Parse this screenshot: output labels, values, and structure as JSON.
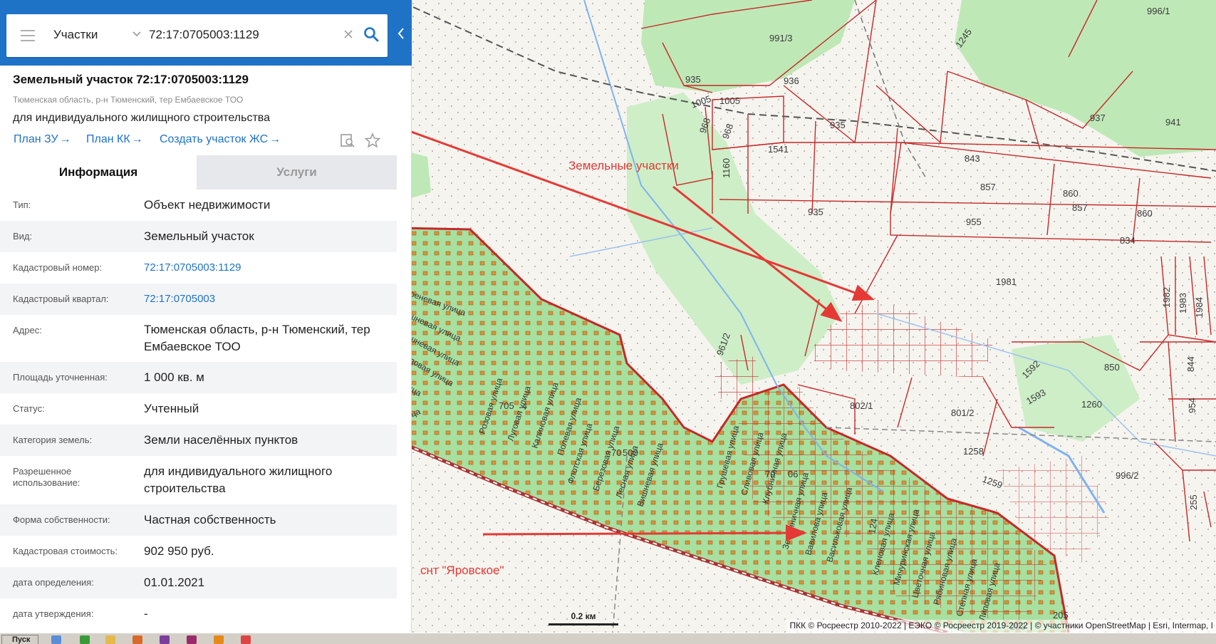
{
  "search": {
    "layer": "Участки",
    "query": "72:17:0705003:1129"
  },
  "parcel": {
    "title": "Земельный участок 72:17:0705003:1129",
    "address": "Тюменская область, р-н Тюменский, тер Ембаевское ТОО",
    "use": "для индивидуального жилищного строительства",
    "links": [
      "План ЗУ",
      "План КК",
      "Создать участок ЖС"
    ]
  },
  "tabs": [
    "Информация",
    "Услуги"
  ],
  "info": [
    {
      "label": "Тип:",
      "value": "Объект недвижимости"
    },
    {
      "label": "Вид:",
      "value": "Земельный участок"
    },
    {
      "label": "Кадастровый номер:",
      "value": "72:17:0705003:1129"
    },
    {
      "label": "Кадастровый квартал:",
      "value": "72:17:0705003"
    },
    {
      "label": "Адрес:",
      "value": "Тюменская область, р-н Тюменский, тер Ембаевское ТОО"
    },
    {
      "label": "Площадь уточненная:",
      "value": "1 000 кв. м"
    },
    {
      "label": "Статус:",
      "value": "Учтенный"
    },
    {
      "label": "Категория земель:",
      "value": "Земли населённых пунктов"
    },
    {
      "label": "Разрешенное использование:",
      "value": "для индивидуального жилищного строительства"
    },
    {
      "label": "Форма собственности:",
      "value": "Частная собственность"
    },
    {
      "label": "Кадастровая стоимость:",
      "value": "902 950 руб."
    },
    {
      "label": "дата определения:",
      "value": "01.01.2021"
    },
    {
      "label": "дата утверждения:",
      "value": "-"
    }
  ],
  "map": {
    "annotations": [
      "Земельные участки",
      "снт \"Яровское\""
    ],
    "parcel_numbers": [
      "991/3",
      "996/1",
      "1245",
      "935",
      "936",
      "937",
      "941",
      "1005",
      "1005",
      "968",
      "968",
      "935",
      "1541",
      "1160",
      "843",
      "857",
      "857",
      "860",
      "860",
      "935",
      "955",
      "834",
      "1981",
      "1982",
      "1983",
      "1984",
      "961/2",
      "850",
      "1592",
      "1593",
      "844",
      "802/1",
      "801/2",
      "1260",
      "954",
      "1258",
      "1259",
      "996/2",
      "255",
      "205",
      "203",
      "95"
    ],
    "block_labels": [
      "705",
      "4",
      "70",
      "500",
      "70",
      "06",
      "124"
    ],
    "streets": [
      "Сиреневая улица",
      "Сиреневая улица",
      "Вишневая улица",
      "Вишневая улица",
      "Садовая улица",
      "улица",
      "улица",
      "Розовая улица",
      "Луговая улица",
      "Калиновая улица",
      "Полевая улица",
      "Флотская улица",
      "Березовая улица",
      "Лесная улица",
      "Вишневая улица",
      "Грушевая улица",
      "Сливовая улица",
      "Клубничная улица",
      "Земляничная улица",
      "Вавилова улица",
      "Васильковая улица",
      "Кленовая улица",
      "Мичуринская улица",
      "Цветочная улица",
      "Рябиновая улица",
      "Степная улица",
      "Липовая улица"
    ],
    "scale": "0.2 км",
    "attribution": "ПКК © Росреестр 2010-2022 | ЕЭКО © Росреестр 2019-2022 | © участники OpenStreetMap | Esri, Intermap, I"
  },
  "taskbar": {
    "start": "Пуск"
  },
  "colors": {
    "header": "#1f73c7",
    "link": "#1f73c7",
    "parcel_border": "#c62828",
    "green_area": "#a8e0a0",
    "arrow": "#e53935"
  }
}
